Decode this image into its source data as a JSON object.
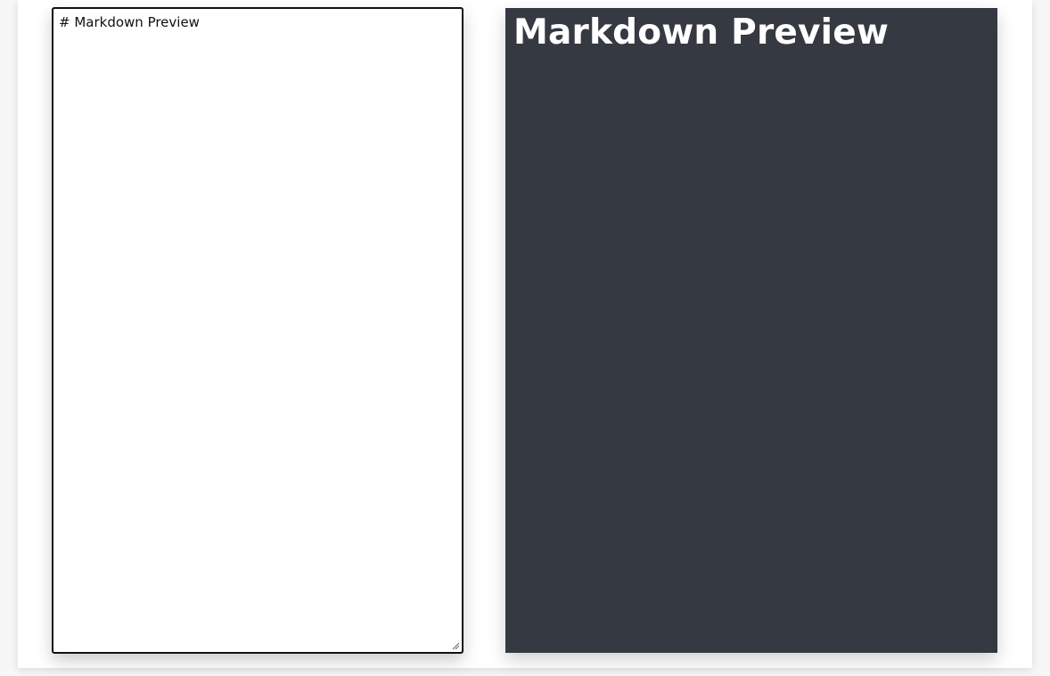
{
  "editor": {
    "value": "# Markdown Preview"
  },
  "preview": {
    "heading": "Markdown Preview"
  },
  "colors": {
    "page_background": "#f7f7f7",
    "card_background": "#ffffff",
    "editor_border": "#111111",
    "preview_background": "#353941",
    "preview_text": "#ffffff"
  },
  "icons": {
    "resize_grip": "resize-grip-icon"
  }
}
